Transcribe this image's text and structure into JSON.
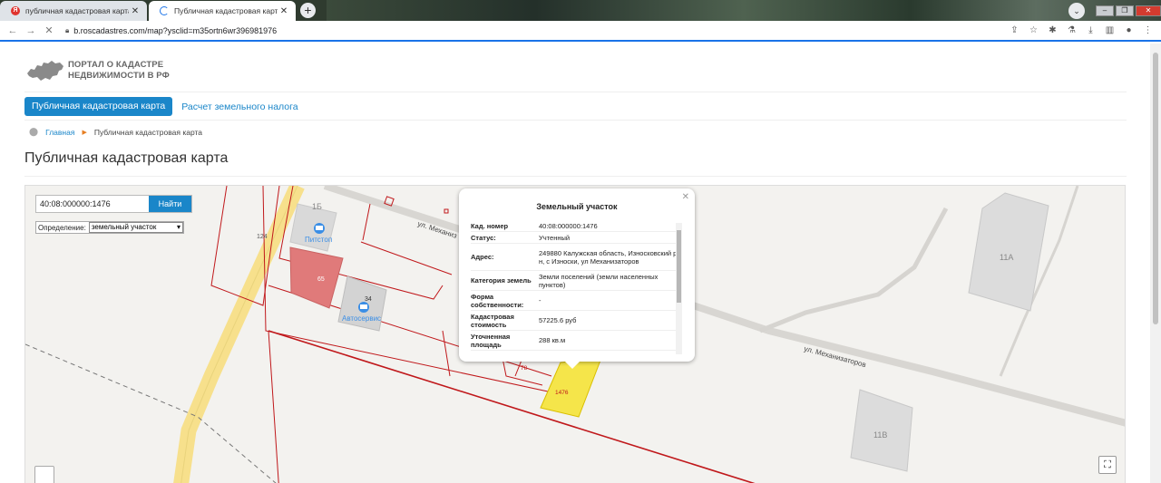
{
  "browser": {
    "tabs": [
      {
        "title": "публичная кадастровая карта – ",
        "active": false
      },
      {
        "title": "Публичная кадастровая карта",
        "active": true
      }
    ],
    "new_tab_label": "+",
    "url": "b.roscadastres.com/map?ysclid=m35ortn6wr396981976"
  },
  "site": {
    "logo_line1": "ПОРТАЛ О КАДАСТРЕ",
    "logo_line2": "НЕДВИЖИМОСТИ В РФ",
    "menu": [
      {
        "label": "Публичная кадастровая карта",
        "active": true
      },
      {
        "label": "Расчет земельного налога",
        "active": false
      }
    ],
    "breadcrumb": {
      "home": "Главная",
      "current": "Публичная кадастровая карта"
    },
    "page_title": "Публичная кадастровая карта"
  },
  "map": {
    "search_value": "40:08:000000:1476",
    "search_button": "Найти",
    "definition_label": "Определение:",
    "definition_value": "земельный участок",
    "street_label": "ул. Механизаторов",
    "street_label_short": "ул. Механиз",
    "labels": {
      "b1": "1Б",
      "n124": "124",
      "pitstop": "Питстоп",
      "n65": "65",
      "n34": "34",
      "autoservice": "Автосервис",
      "n78": "78",
      "n1476": "1476",
      "b11a": "11А",
      "b11b": "11В"
    },
    "popup": {
      "title": "Земельный участок",
      "rows": [
        {
          "key": "Кад. номер",
          "value": "40:08:000000:1476"
        },
        {
          "key": "Статус:",
          "value": "Учтенный"
        },
        {
          "key": "Адрес:",
          "value": "249880 Калужская область, Износковский р-н, с Износки, ул Механизаторов"
        },
        {
          "key": "Категория земель",
          "value": "Земли поселений (земли населенных пунктов)"
        },
        {
          "key": "Форма собственности:",
          "value": "-"
        },
        {
          "key": "Кадастровая стоимость",
          "value": "57225.6 руб"
        },
        {
          "key": "Уточненная площадь",
          "value": "288 кв.м"
        }
      ]
    },
    "colors": {
      "accent": "#1a86c9",
      "parcel_line": "#c0181b",
      "selected_parcel": "#f5e54a",
      "building_red": "#e07a7a"
    }
  }
}
